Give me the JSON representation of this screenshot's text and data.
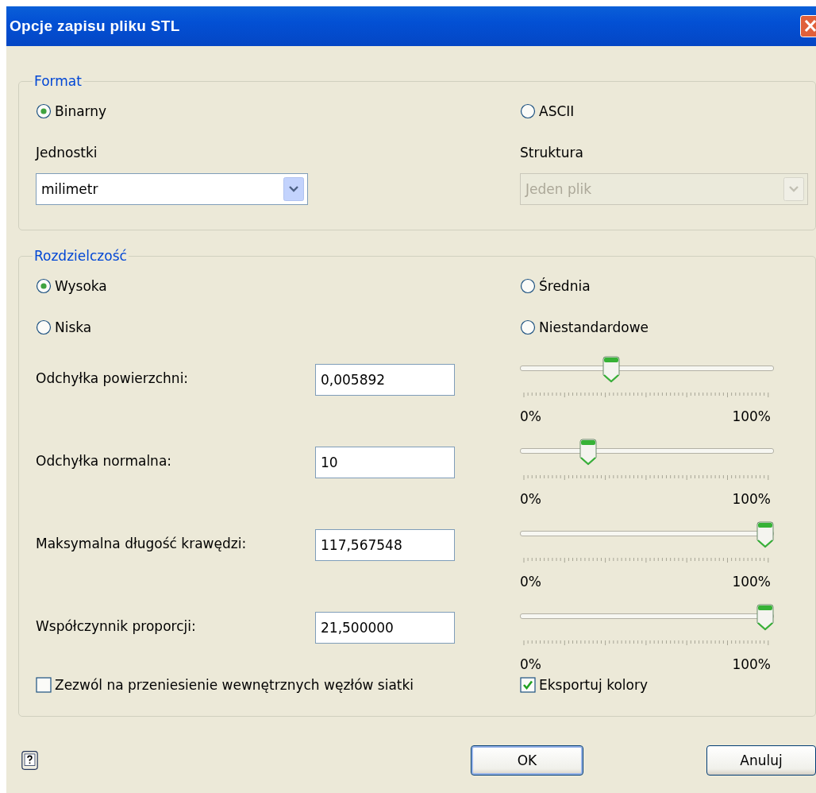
{
  "window": {
    "title": "Opcje zapisu pliku STL"
  },
  "format": {
    "legend": "Format",
    "options": [
      {
        "label": "Binarny",
        "selected": true
      },
      {
        "label": "ASCII",
        "selected": false
      }
    ],
    "fields": [
      {
        "label": "Jednostki",
        "value": "milimetr",
        "disabled": false
      },
      {
        "label": "Struktura",
        "value": "Jeden plik",
        "disabled": true
      }
    ]
  },
  "resolution": {
    "legend": "Rozdzielczość",
    "options": [
      {
        "label": "Wysoka",
        "selected": true
      },
      {
        "label": "Średnia",
        "selected": false
      },
      {
        "label": "Niska",
        "selected": false
      },
      {
        "label": "Niestandardowe",
        "selected": false
      }
    ],
    "params": [
      {
        "label": "Odchyłka powierzchni:",
        "value": "0,005892",
        "level": 0.35,
        "min_label": "0%",
        "max_label": "100%"
      },
      {
        "label": "Odchyłka normalna:",
        "value": "10",
        "level": 0.25,
        "min_label": "0%",
        "max_label": "100%"
      },
      {
        "label": "Maksymalna długość krawędzi:",
        "value": "117,567548",
        "level": 1,
        "min_label": "0%",
        "max_label": "100%"
      },
      {
        "label": "Współczynnik proporcji:",
        "value": "21,500000",
        "level": 1,
        "min_label": "0%",
        "max_label": "100%"
      }
    ],
    "checkboxes": [
      {
        "label": "Zezwól na przeniesienie wewnętrznych węzłów siatki",
        "checked": false
      },
      {
        "label": "Eksportuj kolory",
        "checked": true
      }
    ]
  },
  "buttons": [
    {
      "label": "OK",
      "default": true
    },
    {
      "label": "Anuluj",
      "default": false
    }
  ]
}
